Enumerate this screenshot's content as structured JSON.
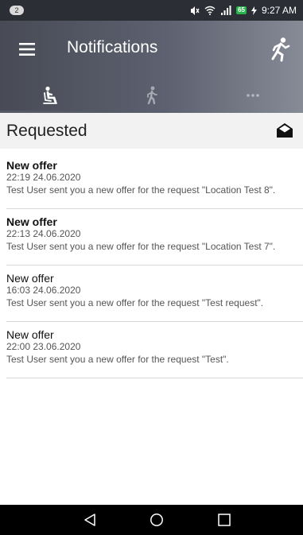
{
  "status_bar": {
    "notification_count": "2",
    "battery": "65",
    "time": "9:27 AM"
  },
  "app_bar": {
    "title": "Notifications",
    "menu_icon": "hamburger-menu-icon",
    "action_icon": "running-person-icon"
  },
  "tabs": [
    {
      "icon": "seated-person-icon",
      "selected": true
    },
    {
      "icon": "walking-person-icon",
      "selected": false
    },
    {
      "icon": "more-dots-icon",
      "selected": false
    }
  ],
  "section": {
    "title": "Requested",
    "action_icon": "open-envelope-icon"
  },
  "notifications": [
    {
      "title": "New offer",
      "time": "22:19 24.06.2020",
      "text": "Test User sent you a new offer for the request \"Location Test 8\".",
      "unread": true
    },
    {
      "title": "New offer",
      "time": "22:13 24.06.2020",
      "text": "Test User sent you a new offer for the request \"Location Test 7\".",
      "unread": true
    },
    {
      "title": "New offer",
      "time": "16:03 24.06.2020",
      "text": "Test User sent you a new offer for the request \"Test request\".",
      "unread": false
    },
    {
      "title": "New offer",
      "time": "22:00 23.06.2020",
      "text": "Test User sent you a new offer for the request \"Test\".",
      "unread": false
    }
  ],
  "colors": {
    "app_bar_dark": "#484b55",
    "app_bar_light": "#878b96",
    "status_bar": "#2b2e35",
    "battery_badge": "#27b34a",
    "section_background": "#f2f2f2"
  }
}
